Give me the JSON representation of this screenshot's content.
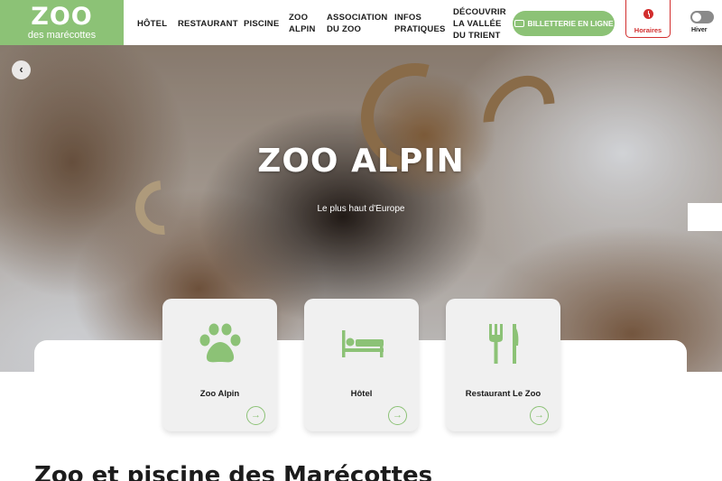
{
  "header": {
    "logo_main": "ZOO",
    "logo_sub": "des marécottes",
    "nav": [
      {
        "label": "HÔTEL"
      },
      {
        "label": "RESTAURANT"
      },
      {
        "label": "PISCINE"
      },
      {
        "line1": "ZOO",
        "line2": "ALPIN"
      },
      {
        "line1": "ASSOCIATION",
        "line2": "DU ZOO"
      },
      {
        "line1": "INFOS",
        "line2": "PRATIQUES"
      },
      {
        "line1": "DÉCOUVRIR",
        "line2": "LA VALLÉE",
        "line3": "DU TRIENT"
      }
    ],
    "tickets_label": "BILLETTERIE EN LIGNE",
    "tickets_icon": "ticket-icon",
    "horaires_label": "Horaires",
    "horaires_icon": "clock-icon",
    "season_label": "Hiver",
    "brand_color": "#8cc276",
    "alert_color": "#d22e2e"
  },
  "hero": {
    "title": "ZOO ALPIN",
    "subtitle": "Le plus haut d'Europe",
    "prev_icon": "chevron-left-icon"
  },
  "cards": [
    {
      "label": "Zoo Alpin",
      "icon": "paw-icon",
      "arrow_icon": "arrow-right-icon"
    },
    {
      "label": "Hôtel",
      "icon": "bed-icon",
      "arrow_icon": "arrow-right-icon"
    },
    {
      "label": "Restaurant Le Zoo",
      "icon": "fork-knife-icon",
      "arrow_icon": "arrow-right-icon"
    }
  ],
  "main": {
    "section_title": "Zoo et piscine des Marécottes"
  }
}
